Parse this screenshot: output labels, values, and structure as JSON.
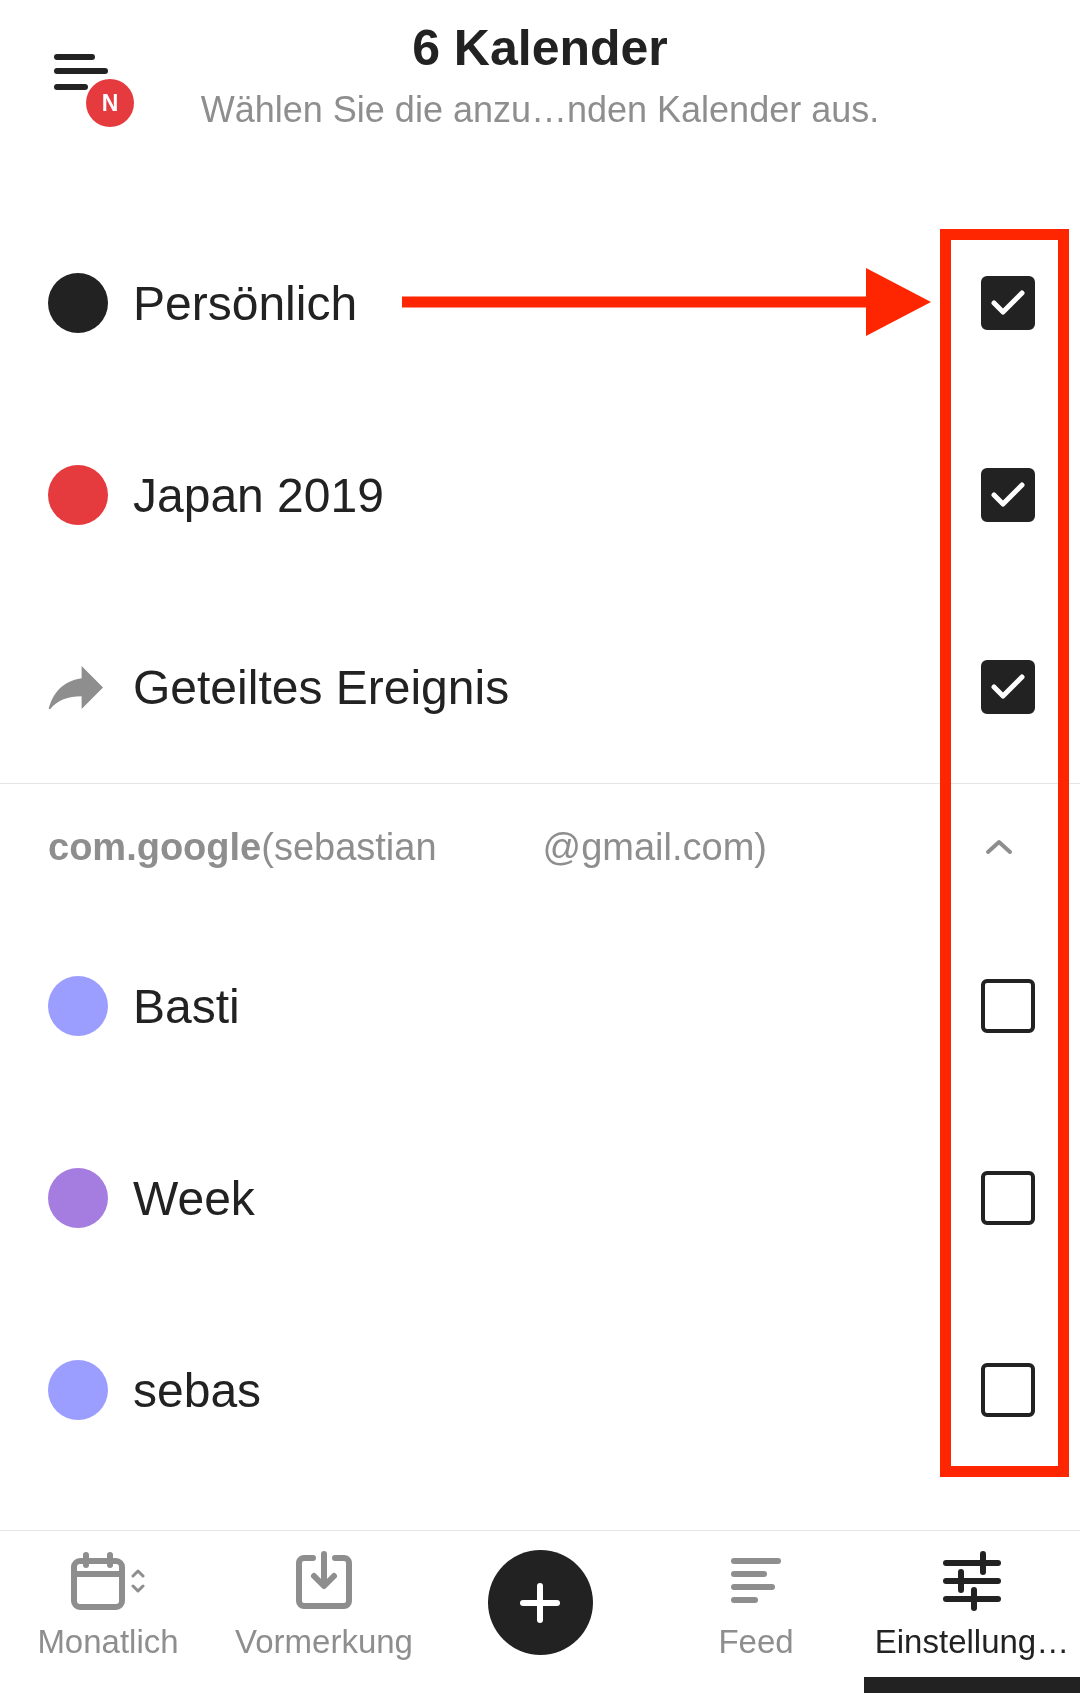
{
  "header": {
    "title": "6 Kalender",
    "subtitle": "Wählen Sie die anzu…nden Kalender aus.",
    "menu_badge": "N"
  },
  "calendars": [
    {
      "kind": "dot",
      "name": "Persönlich",
      "color": "#222222",
      "checked": true
    },
    {
      "kind": "dot",
      "name": "Japan 2019",
      "color": "#e53b3e",
      "checked": true
    },
    {
      "kind": "shared",
      "name": "Geteiltes Ereignis",
      "checked": true
    }
  ],
  "accounts": [
    {
      "title": "**com.google**(sebastian",
      "title_end": "@gmail.com)",
      "expanded": true,
      "calendars": [
        {
          "kind": "dot",
          "name": "Basti",
          "color": "#9c9eff",
          "checked": false
        },
        {
          "kind": "dot",
          "name": "Week",
          "color": "#a57ce0",
          "checked": false
        },
        {
          "kind": "dot",
          "name": "sebas",
          "color": "#9c9eff",
          "checked": false
        }
      ]
    }
  ],
  "annotation": {
    "arrow": true,
    "highlight_frame": true
  },
  "bottom_nav": [
    {
      "kind": "tab",
      "label": "Monatlich",
      "selected": false
    },
    {
      "kind": "tab",
      "label": "Vormerkung",
      "selected": false
    },
    {
      "kind": "fab"
    },
    {
      "kind": "tab",
      "label": "Feed",
      "selected": false
    },
    {
      "kind": "tab",
      "label": "Einstellung…",
      "selected": true
    }
  ]
}
